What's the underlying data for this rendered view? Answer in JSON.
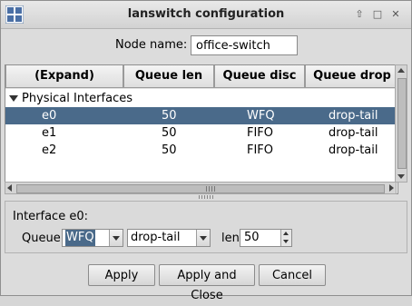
{
  "window": {
    "title": "lanswitch configuration",
    "buttons": [
      "up-icon",
      "maximize-icon",
      "close-icon"
    ]
  },
  "node": {
    "label": "Node name:",
    "value": "office-switch"
  },
  "table": {
    "headers": [
      "(Expand)",
      "Queue len",
      "Queue disc",
      "Queue drop"
    ],
    "group": "Physical Interfaces",
    "rows": [
      {
        "name": "e0",
        "len": "50",
        "disc": "WFQ",
        "drop": "drop-tail",
        "selected": true
      },
      {
        "name": "e1",
        "len": "50",
        "disc": "FIFO",
        "drop": "drop-tail",
        "selected": false
      },
      {
        "name": "e2",
        "len": "50",
        "disc": "FIFO",
        "drop": "drop-tail",
        "selected": false
      }
    ]
  },
  "interface": {
    "title": "Interface e0:",
    "queue_label": "Queue",
    "queue_disc": "WFQ",
    "queue_drop": "drop-tail",
    "len_label": "len",
    "len_value": "50"
  },
  "actions": {
    "apply": "Apply",
    "apply_close": "Apply and Close",
    "cancel": "Cancel"
  },
  "colors": {
    "selection": "#4a6a8a",
    "window_bg": "#dcdcdc"
  }
}
